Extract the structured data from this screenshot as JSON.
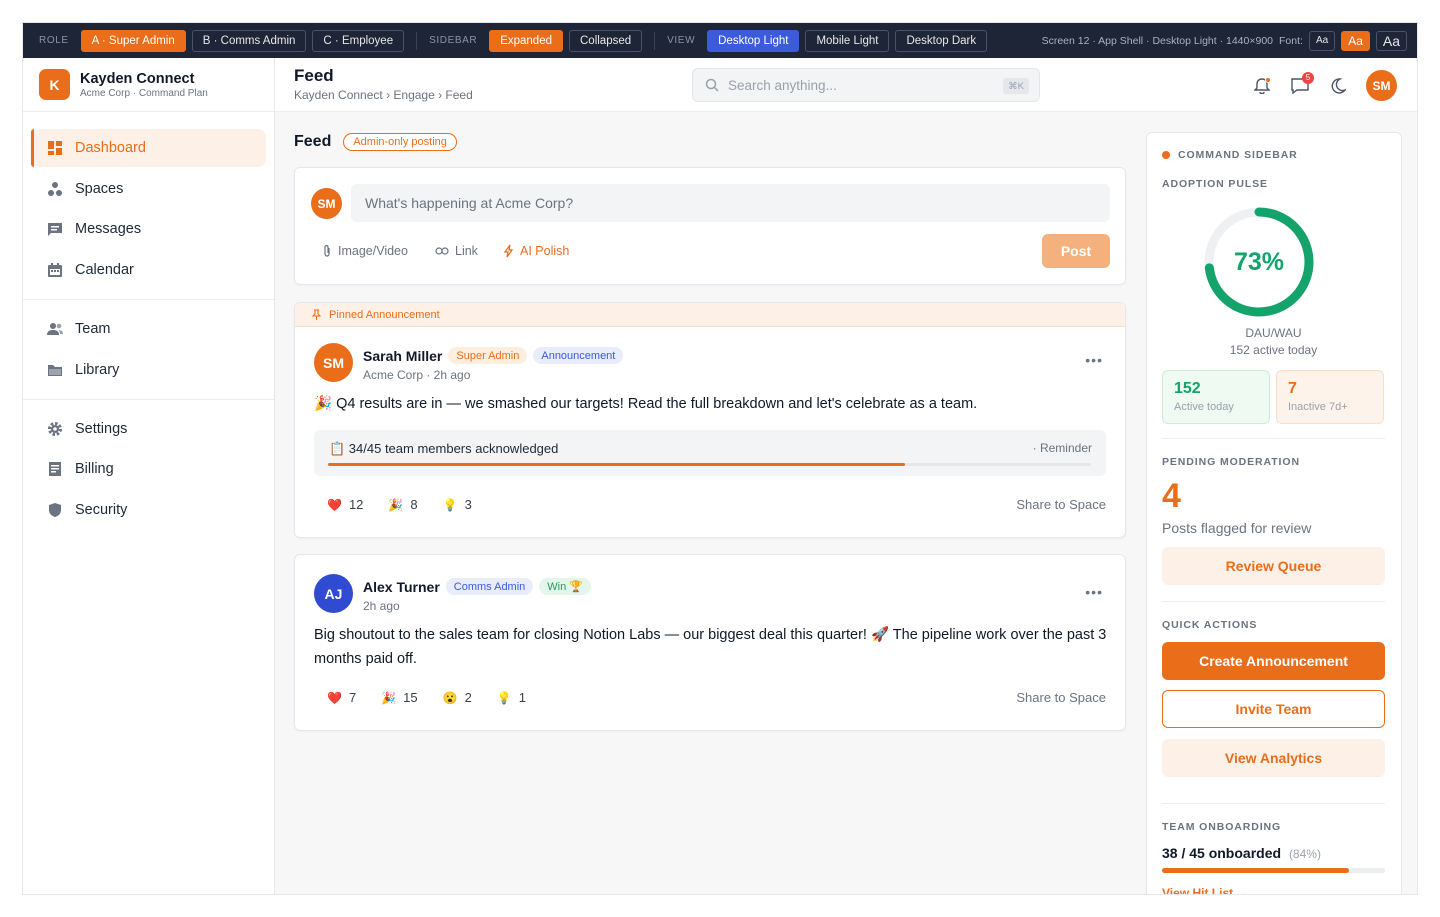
{
  "topbar": {
    "role_label": "ROLE",
    "roles": [
      "A · Super Admin",
      "B · Comms Admin",
      "C · Employee"
    ],
    "sidebar_label": "SIDEBAR",
    "sidebar_modes": [
      "Expanded",
      "Collapsed"
    ],
    "view_label": "VIEW",
    "views": [
      "Desktop Light",
      "Mobile Light",
      "Desktop Dark"
    ],
    "screen_info": "Screen 12 · App Shell · Desktop Light · 1440×900",
    "font_label": "Font:",
    "font_sizes": [
      "Aa",
      "Aa",
      "Aa"
    ]
  },
  "brand": {
    "logo_letter": "K",
    "name": "Kayden Connect",
    "sub": "Acme Corp · Command Plan"
  },
  "sidebar": {
    "items": [
      {
        "label": "Dashboard",
        "icon": "dashboard-icon"
      },
      {
        "label": "Spaces",
        "icon": "spaces-icon"
      },
      {
        "label": "Messages",
        "icon": "messages-icon"
      },
      {
        "label": "Calendar",
        "icon": "calendar-icon"
      },
      {
        "label": "Team",
        "icon": "team-icon"
      },
      {
        "label": "Library",
        "icon": "folder-icon"
      },
      {
        "label": "Settings",
        "icon": "gear-icon"
      },
      {
        "label": "Billing",
        "icon": "billing-icon"
      },
      {
        "label": "Security",
        "icon": "shield-icon"
      }
    ]
  },
  "header": {
    "title": "Feed",
    "breadcrumb": "Kayden Connect › Engage › Feed",
    "search_placeholder": "Search anything...",
    "search_shortcut": "⌘K",
    "messages_badge": "5",
    "avatar": "SM"
  },
  "feed": {
    "title": "Feed",
    "posting_pill": "Admin-only posting",
    "composer": {
      "avatar": "SM",
      "placeholder": "What's happening at Acme Corp?",
      "image_video": "Image/Video",
      "link": "Link",
      "ai_polish": "AI Polish",
      "post": "Post"
    },
    "post1": {
      "pinned": "Pinned Announcement",
      "avatar": "SM",
      "author": "Sarah Miller",
      "role_tag": "Super Admin",
      "type_tag": "Announcement",
      "meta": "Acme Corp · 2h ago",
      "body": "🎉 Q4 results are in — we smashed our targets! Read the full breakdown and let's celebrate as a team.",
      "ack_text": "📋 34/45 team members acknowledged",
      "ack_reminder": "· Reminder",
      "ack_progress": 0.756,
      "reactions": [
        {
          "emoji": "❤️",
          "count": "12"
        },
        {
          "emoji": "🎉",
          "count": "8"
        },
        {
          "emoji": "💡",
          "count": "3"
        }
      ],
      "share": "Share to Space"
    },
    "post2": {
      "avatar": "AJ",
      "author": "Alex Turner",
      "role_tag": "Comms Admin",
      "type_tag": "Win 🏆",
      "meta": "2h ago",
      "body": "Big shoutout to the sales team for closing Notion Labs — our biggest deal this quarter! 🚀 The pipeline work over the past 3 months paid off.",
      "reactions": [
        {
          "emoji": "❤️",
          "count": "7"
        },
        {
          "emoji": "🎉",
          "count": "15"
        },
        {
          "emoji": "😮",
          "count": "2"
        },
        {
          "emoji": "💡",
          "count": "1"
        }
      ],
      "share": "Share to Space"
    }
  },
  "rpanel": {
    "title": "COMMAND SIDEBAR",
    "adoption_title": "ADOPTION PULSE",
    "adoption_pct": "73%",
    "adoption_value": 0.73,
    "dau_label": "DAU/WAU",
    "active_sub": "152 active today",
    "active_num": "152",
    "active_label": "Active today",
    "inactive_num": "7",
    "inactive_label": "Inactive 7d+",
    "moderation_title": "PENDING MODERATION",
    "moderation_num": "4",
    "moderation_label": "Posts flagged for review",
    "review_btn": "Review Queue",
    "quick_title": "QUICK ACTIONS",
    "create_btn": "Create Announcement",
    "invite_btn": "Invite Team",
    "analytics_btn": "View Analytics",
    "onboarding_title": "TEAM ONBOARDING",
    "onboarding_text": "38 / 45 onboarded",
    "onboarding_pct": "(84%)",
    "onboarding_progress": 0.84,
    "hitlist_link": "View Hit List →"
  },
  "colors": {
    "accent": "#ea6d1a",
    "success": "#13a36b",
    "blue": "#3b5bdb",
    "topbar": "#1e2536"
  }
}
